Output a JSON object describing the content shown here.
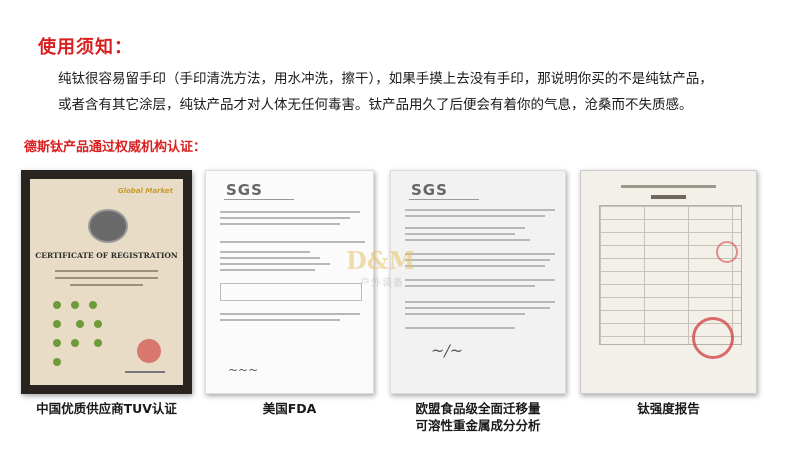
{
  "notice": {
    "title": "使用须知：",
    "line1": "纯钛很容易留手印（手印清洗方法，用水冲洗，擦干），如果手摸上去没有手印，那说明你买的不是纯钛产品，",
    "line2": "或者含有其它涂层，纯钛产品才对人体无任何毒害。钛产品用久了后便会有着你的气息，沧桑而不失质感。"
  },
  "certifications": {
    "heading": "德斯钛产品通过权威机构认证：",
    "items": [
      {
        "caption": "中国优质供应商TUV认证",
        "brand": "Global Market",
        "doc_title": "CERTIFICATE OF REGISTRATION"
      },
      {
        "caption": "美国FDA",
        "logo": "SGS"
      },
      {
        "caption_line1": "欧盟食品级全面迁移量",
        "caption_line2": "可溶性重金属成分分析",
        "logo": "SGS"
      },
      {
        "caption": "钛强度报告"
      }
    ]
  },
  "watermark": {
    "logo": "D&M",
    "text": "户外装备"
  },
  "colors": {
    "accent_red": "#d91f1f",
    "body_text": "#1a1a1a"
  }
}
